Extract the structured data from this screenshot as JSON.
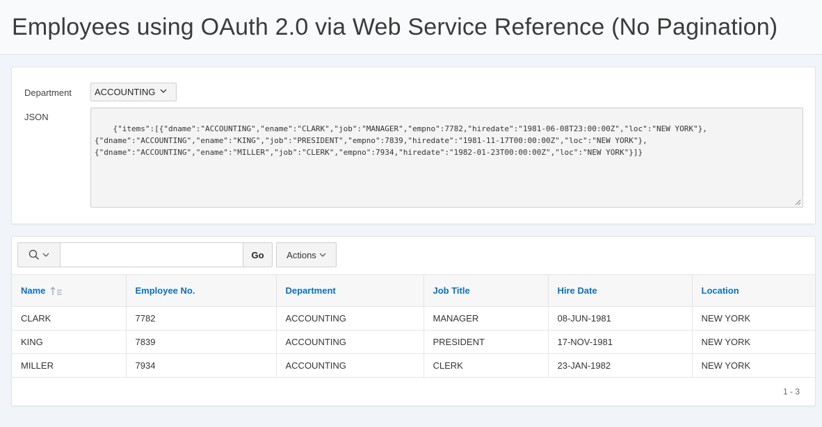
{
  "page": {
    "title": "Employees using OAuth 2.0 via Web Service Reference (No Pagination)"
  },
  "form": {
    "department_label": "Department",
    "department_value": "ACCOUNTING",
    "json_label": "JSON",
    "json_value": "{\"items\":[{\"dname\":\"ACCOUNTING\",\"ename\":\"CLARK\",\"job\":\"MANAGER\",\"empno\":7782,\"hiredate\":\"1981-06-08T23:00:00Z\",\"loc\":\"NEW YORK\"},\n{\"dname\":\"ACCOUNTING\",\"ename\":\"KING\",\"job\":\"PRESIDENT\",\"empno\":7839,\"hiredate\":\"1981-11-17T00:00:00Z\",\"loc\":\"NEW YORK\"},\n{\"dname\":\"ACCOUNTING\",\"ename\":\"MILLER\",\"job\":\"CLERK\",\"empno\":7934,\"hiredate\":\"1982-01-23T00:00:00Z\",\"loc\":\"NEW YORK\"}]}"
  },
  "report": {
    "search_placeholder": "",
    "go_label": "Go",
    "actions_label": "Actions",
    "columns": [
      "Name",
      "Employee No.",
      "Department",
      "Job Title",
      "Hire Date",
      "Location"
    ],
    "rows": [
      [
        "CLARK",
        "7782",
        "ACCOUNTING",
        "MANAGER",
        "08-JUN-1981",
        "NEW YORK"
      ],
      [
        "KING",
        "7839",
        "ACCOUNTING",
        "PRESIDENT",
        "17-NOV-1981",
        "NEW YORK"
      ],
      [
        "MILLER",
        "7934",
        "ACCOUNTING",
        "CLERK",
        "23-JAN-1982",
        "NEW YORK"
      ]
    ],
    "pagination": "1 - 3"
  },
  "icons": {
    "search": "search-icon",
    "chevron": "chevron-down-icon",
    "sort": "sort-ascending-icon",
    "resize": "resize-grip-icon"
  },
  "colors": {
    "header_link": "#0b6fbf",
    "page_background": "#f1f4f8"
  }
}
